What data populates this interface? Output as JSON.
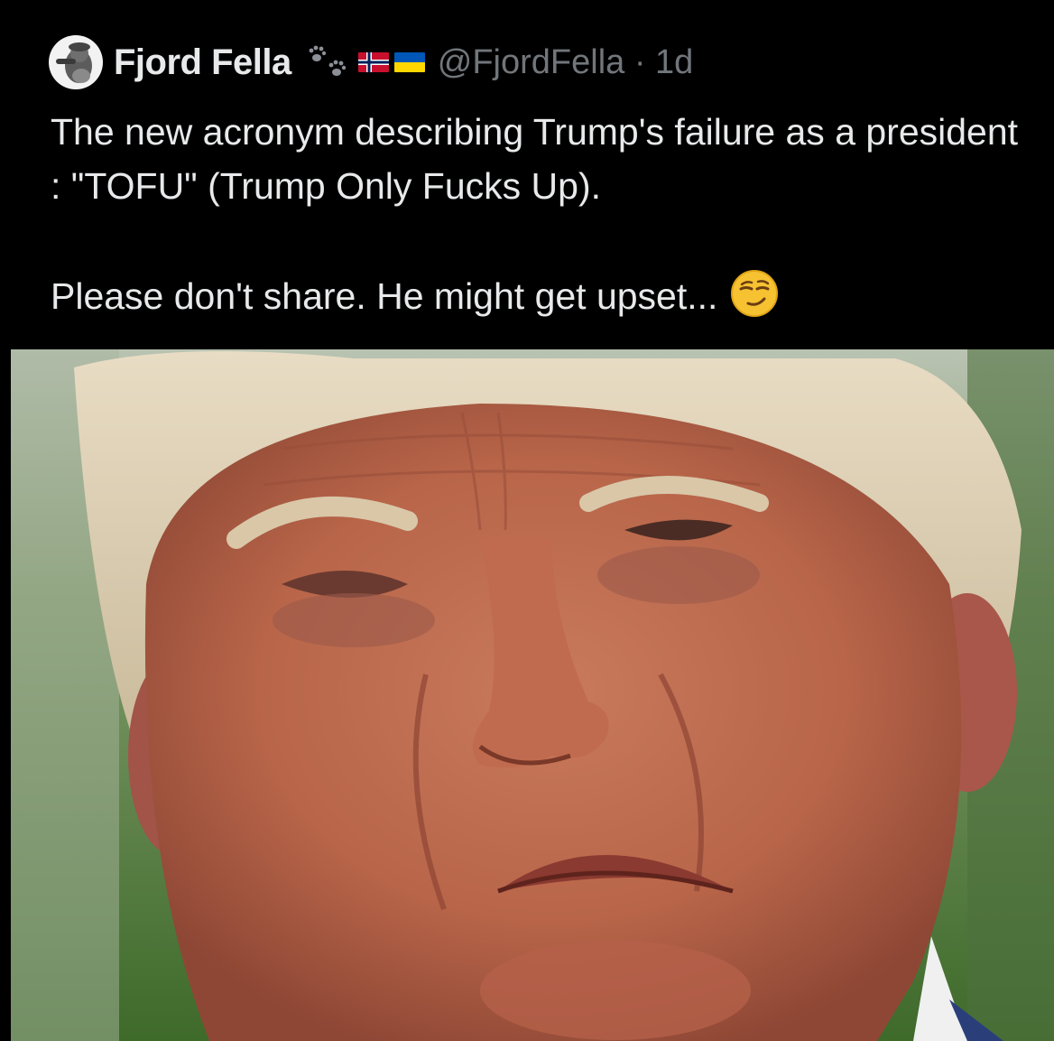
{
  "post": {
    "author": {
      "display_name": "Fjord Fella",
      "handle": "@FjordFella",
      "separator": "·",
      "time_ago": "1d",
      "avatar_icon": "avatar-icon",
      "name_decorations": [
        "paw-prints-icon",
        "norway-flag-icon",
        "ukraine-flag-icon"
      ]
    },
    "text": {
      "line1": "The new acronym describing Trump's failure as a president : \"TOFU\"  (Trump Only Fucks Up).",
      "line2": "Please don't share. He might get upset...",
      "emoji": "smirking-face-emoji"
    },
    "media": {
      "icon": "photo-of-man-frowning"
    }
  },
  "colors": {
    "background": "#000000",
    "text_primary": "#e7e9ea",
    "text_secondary": "#71767b"
  }
}
